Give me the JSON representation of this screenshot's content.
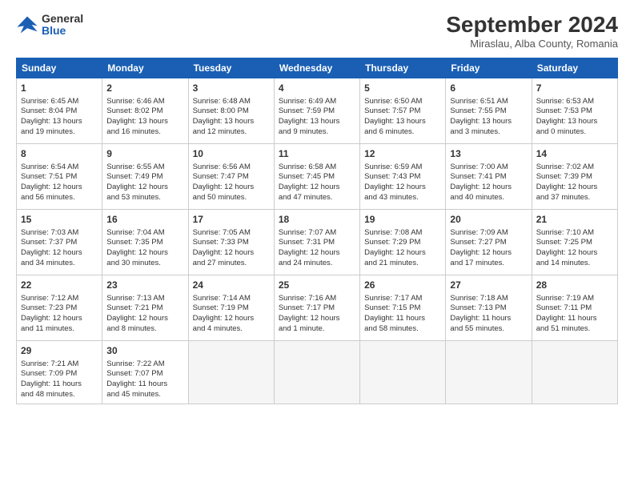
{
  "header": {
    "logo_line1": "General",
    "logo_line2": "Blue",
    "month": "September 2024",
    "location": "Miraslau, Alba County, Romania"
  },
  "weekdays": [
    "Sunday",
    "Monday",
    "Tuesday",
    "Wednesday",
    "Thursday",
    "Friday",
    "Saturday"
  ],
  "weeks": [
    [
      {
        "day": "1",
        "info": "Sunrise: 6:45 AM\nSunset: 8:04 PM\nDaylight: 13 hours\nand 19 minutes."
      },
      {
        "day": "2",
        "info": "Sunrise: 6:46 AM\nSunset: 8:02 PM\nDaylight: 13 hours\nand 16 minutes."
      },
      {
        "day": "3",
        "info": "Sunrise: 6:48 AM\nSunset: 8:00 PM\nDaylight: 13 hours\nand 12 minutes."
      },
      {
        "day": "4",
        "info": "Sunrise: 6:49 AM\nSunset: 7:59 PM\nDaylight: 13 hours\nand 9 minutes."
      },
      {
        "day": "5",
        "info": "Sunrise: 6:50 AM\nSunset: 7:57 PM\nDaylight: 13 hours\nand 6 minutes."
      },
      {
        "day": "6",
        "info": "Sunrise: 6:51 AM\nSunset: 7:55 PM\nDaylight: 13 hours\nand 3 minutes."
      },
      {
        "day": "7",
        "info": "Sunrise: 6:53 AM\nSunset: 7:53 PM\nDaylight: 13 hours\nand 0 minutes."
      }
    ],
    [
      {
        "day": "8",
        "info": "Sunrise: 6:54 AM\nSunset: 7:51 PM\nDaylight: 12 hours\nand 56 minutes."
      },
      {
        "day": "9",
        "info": "Sunrise: 6:55 AM\nSunset: 7:49 PM\nDaylight: 12 hours\nand 53 minutes."
      },
      {
        "day": "10",
        "info": "Sunrise: 6:56 AM\nSunset: 7:47 PM\nDaylight: 12 hours\nand 50 minutes."
      },
      {
        "day": "11",
        "info": "Sunrise: 6:58 AM\nSunset: 7:45 PM\nDaylight: 12 hours\nand 47 minutes."
      },
      {
        "day": "12",
        "info": "Sunrise: 6:59 AM\nSunset: 7:43 PM\nDaylight: 12 hours\nand 43 minutes."
      },
      {
        "day": "13",
        "info": "Sunrise: 7:00 AM\nSunset: 7:41 PM\nDaylight: 12 hours\nand 40 minutes."
      },
      {
        "day": "14",
        "info": "Sunrise: 7:02 AM\nSunset: 7:39 PM\nDaylight: 12 hours\nand 37 minutes."
      }
    ],
    [
      {
        "day": "15",
        "info": "Sunrise: 7:03 AM\nSunset: 7:37 PM\nDaylight: 12 hours\nand 34 minutes."
      },
      {
        "day": "16",
        "info": "Sunrise: 7:04 AM\nSunset: 7:35 PM\nDaylight: 12 hours\nand 30 minutes."
      },
      {
        "day": "17",
        "info": "Sunrise: 7:05 AM\nSunset: 7:33 PM\nDaylight: 12 hours\nand 27 minutes."
      },
      {
        "day": "18",
        "info": "Sunrise: 7:07 AM\nSunset: 7:31 PM\nDaylight: 12 hours\nand 24 minutes."
      },
      {
        "day": "19",
        "info": "Sunrise: 7:08 AM\nSunset: 7:29 PM\nDaylight: 12 hours\nand 21 minutes."
      },
      {
        "day": "20",
        "info": "Sunrise: 7:09 AM\nSunset: 7:27 PM\nDaylight: 12 hours\nand 17 minutes."
      },
      {
        "day": "21",
        "info": "Sunrise: 7:10 AM\nSunset: 7:25 PM\nDaylight: 12 hours\nand 14 minutes."
      }
    ],
    [
      {
        "day": "22",
        "info": "Sunrise: 7:12 AM\nSunset: 7:23 PM\nDaylight: 12 hours\nand 11 minutes."
      },
      {
        "day": "23",
        "info": "Sunrise: 7:13 AM\nSunset: 7:21 PM\nDaylight: 12 hours\nand 8 minutes."
      },
      {
        "day": "24",
        "info": "Sunrise: 7:14 AM\nSunset: 7:19 PM\nDaylight: 12 hours\nand 4 minutes."
      },
      {
        "day": "25",
        "info": "Sunrise: 7:16 AM\nSunset: 7:17 PM\nDaylight: 12 hours\nand 1 minute."
      },
      {
        "day": "26",
        "info": "Sunrise: 7:17 AM\nSunset: 7:15 PM\nDaylight: 11 hours\nand 58 minutes."
      },
      {
        "day": "27",
        "info": "Sunrise: 7:18 AM\nSunset: 7:13 PM\nDaylight: 11 hours\nand 55 minutes."
      },
      {
        "day": "28",
        "info": "Sunrise: 7:19 AM\nSunset: 7:11 PM\nDaylight: 11 hours\nand 51 minutes."
      }
    ],
    [
      {
        "day": "29",
        "info": "Sunrise: 7:21 AM\nSunset: 7:09 PM\nDaylight: 11 hours\nand 48 minutes."
      },
      {
        "day": "30",
        "info": "Sunrise: 7:22 AM\nSunset: 7:07 PM\nDaylight: 11 hours\nand 45 minutes."
      },
      {
        "day": "",
        "info": ""
      },
      {
        "day": "",
        "info": ""
      },
      {
        "day": "",
        "info": ""
      },
      {
        "day": "",
        "info": ""
      },
      {
        "day": "",
        "info": ""
      }
    ]
  ]
}
